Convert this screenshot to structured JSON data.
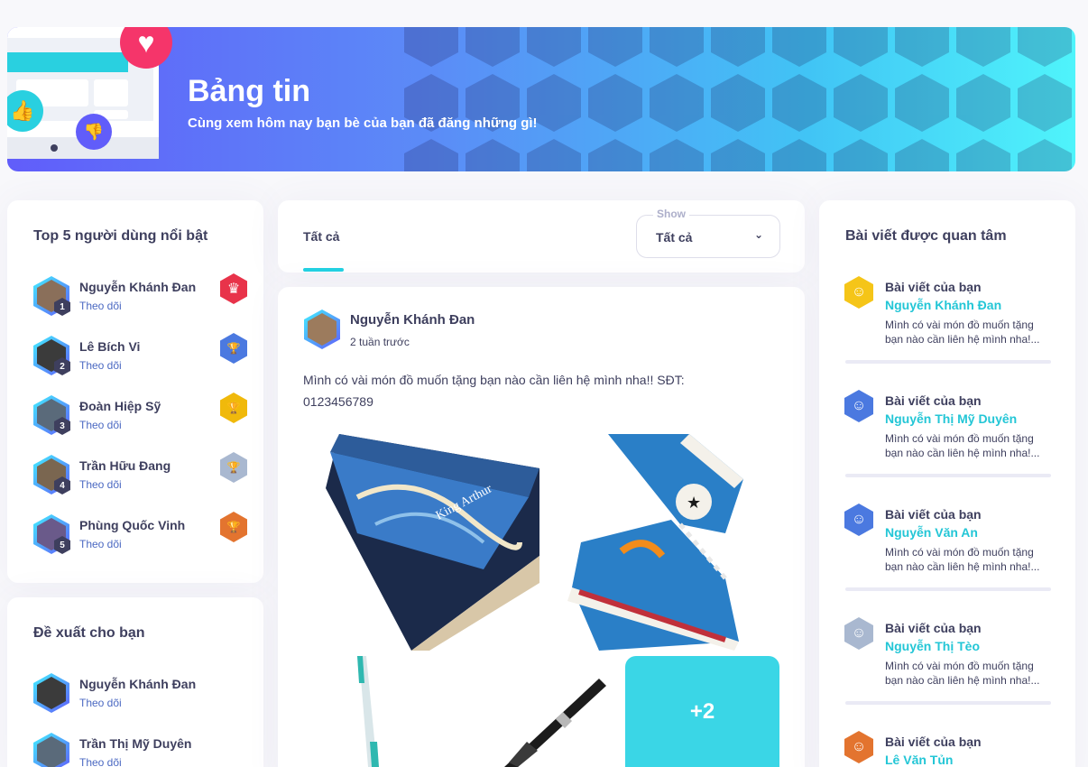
{
  "banner": {
    "title": "Bảng tin",
    "subtitle": "Cùng xem hôm nay bạn bè của bạn đã đăng những gì!",
    "icons": [
      "heart-icon",
      "thumbs-up-icon",
      "thumbs-down-icon"
    ]
  },
  "top_users": {
    "title": "Top 5 người dùng nổi bật",
    "items": [
      {
        "name": "Nguyễn Khánh Đan",
        "follow": "Theo dõi",
        "rank": "1",
        "badge": "crown-badge",
        "badge_color": "#e8334a"
      },
      {
        "name": "Lê Bích Vi",
        "follow": "Theo dõi",
        "rank": "2",
        "badge": "trophy-badge",
        "badge_color": "#4b79e0"
      },
      {
        "name": "Đoàn Hiệp Sỹ",
        "follow": "Theo dõi",
        "rank": "3",
        "badge": "trophy-badge",
        "badge_color": "#f0b90b"
      },
      {
        "name": "Trần Hữu Đang",
        "follow": "Theo dõi",
        "rank": "4",
        "badge": "trophy-badge",
        "badge_color": "#a9b8d0"
      },
      {
        "name": "Phùng Quốc Vinh",
        "follow": "Theo dõi",
        "rank": "5",
        "badge": "trophy-badge",
        "badge_color": "#e3742f"
      }
    ]
  },
  "suggest": {
    "title": "Đề xuất cho bạn",
    "items": [
      {
        "name": "Nguyễn Khánh Đan",
        "follow": "Theo dõi"
      },
      {
        "name": "Trần Thị Mỹ Duyên",
        "follow": "Theo dõi"
      }
    ]
  },
  "feed": {
    "tab": "Tất cả",
    "select_label": "Show",
    "select_value": "Tất cả"
  },
  "post": {
    "author": "Nguyễn Khánh Đan",
    "time": "2 tuần trước",
    "text": "Mình có vài món đồ muốn tặng bạn nào cần liên hệ mình nha!! SĐT: 0123456789",
    "more_count": "+2",
    "photos": [
      "book-photo",
      "sneakers-photo",
      "toothbrush-photo",
      "pen-photo"
    ]
  },
  "popular": {
    "title": "Bài viết được quan tâm",
    "items": [
      {
        "label": "Bài viết của bạn",
        "name": "Nguyễn Khánh Đan",
        "text": "Mình có vài món đồ muốn tặng bạn nào cần liên hệ mình nha!...",
        "color": "#f5c518"
      },
      {
        "label": "Bài viết của bạn",
        "name": "Nguyễn Thị Mỹ Duyên",
        "text": "Mình có vài món đồ muốn tặng bạn nào cần liên hệ mình nha!...",
        "color": "#4b79e0"
      },
      {
        "label": "Bài viết của bạn",
        "name": "Nguyễn Văn An",
        "text": "Mình có vài món đồ muốn tặng bạn nào cần liên hệ mình nha!...",
        "color": "#4b79e0"
      },
      {
        "label": "Bài viết của bạn",
        "name": "Nguyễn Thị Tèo",
        "text": "Mình có vài món đồ muốn tặng bạn nào cần liên hệ mình nha!...",
        "color": "#a9b8d0"
      },
      {
        "label": "Bài viết của bạn",
        "name": "Lê Văn Tủn",
        "text": "",
        "color": "#e3742f"
      }
    ]
  }
}
